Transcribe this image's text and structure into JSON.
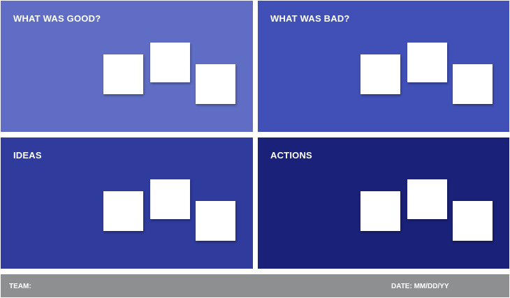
{
  "colors": {
    "good": "#5f6dc4",
    "bad": "#4050b6",
    "ideas": "#2f3c9e",
    "actions": "#1a2178",
    "footer": "#8e8f91",
    "sticky": "#ffffff"
  },
  "quadrants": [
    {
      "title": "WHAT WAS GOOD?"
    },
    {
      "title": "WHAT WAS BAD?"
    },
    {
      "title": "IDEAS"
    },
    {
      "title": "ACTIONS"
    }
  ],
  "footer": {
    "team_label": "TEAM:",
    "date_label": "DATE: MM/DD/YY"
  }
}
